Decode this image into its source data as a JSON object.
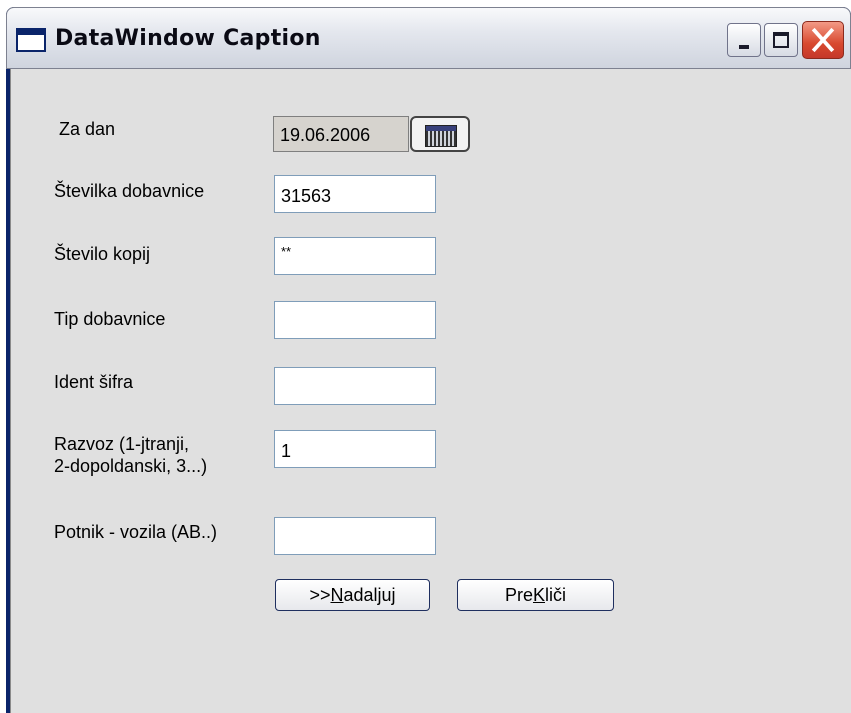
{
  "window": {
    "title": "DataWindow Caption",
    "controls": [
      "minimize",
      "maximize",
      "close"
    ]
  },
  "form": {
    "fields": [
      {
        "label": "Za dan",
        "value": "19.06.2006",
        "type": "date"
      },
      {
        "label": "Številka dobavnice",
        "value": "31563"
      },
      {
        "label": "Število kopij",
        "value": "**"
      },
      {
        "label": "Tip dobavnice",
        "value": ""
      },
      {
        "label": "Ident šifra",
        "value": ""
      },
      {
        "label": "Razvoz (1-jtranji, 2-dopoldanski, 3...)",
        "label_line1": "Razvoz (1-jtranji,",
        "label_line2": "2-dopoldanski, 3...)",
        "value": "1"
      },
      {
        "label": "Potnik - vozila (AB..)",
        "value": ""
      }
    ],
    "calendar_icon": "calendar-icon"
  },
  "buttons": {
    "continue": {
      "prefix": ">>",
      "mnemonic": "N",
      "rest": "adaljuj"
    },
    "cancel": {
      "prefix": "Pre",
      "mnemonic": "K",
      "rest": "liči"
    }
  },
  "colors": {
    "client_bg": "#e0e0e0",
    "title_text": "#0a0a14",
    "close_button": "#d8492f",
    "field_border": "#7f9db9"
  }
}
